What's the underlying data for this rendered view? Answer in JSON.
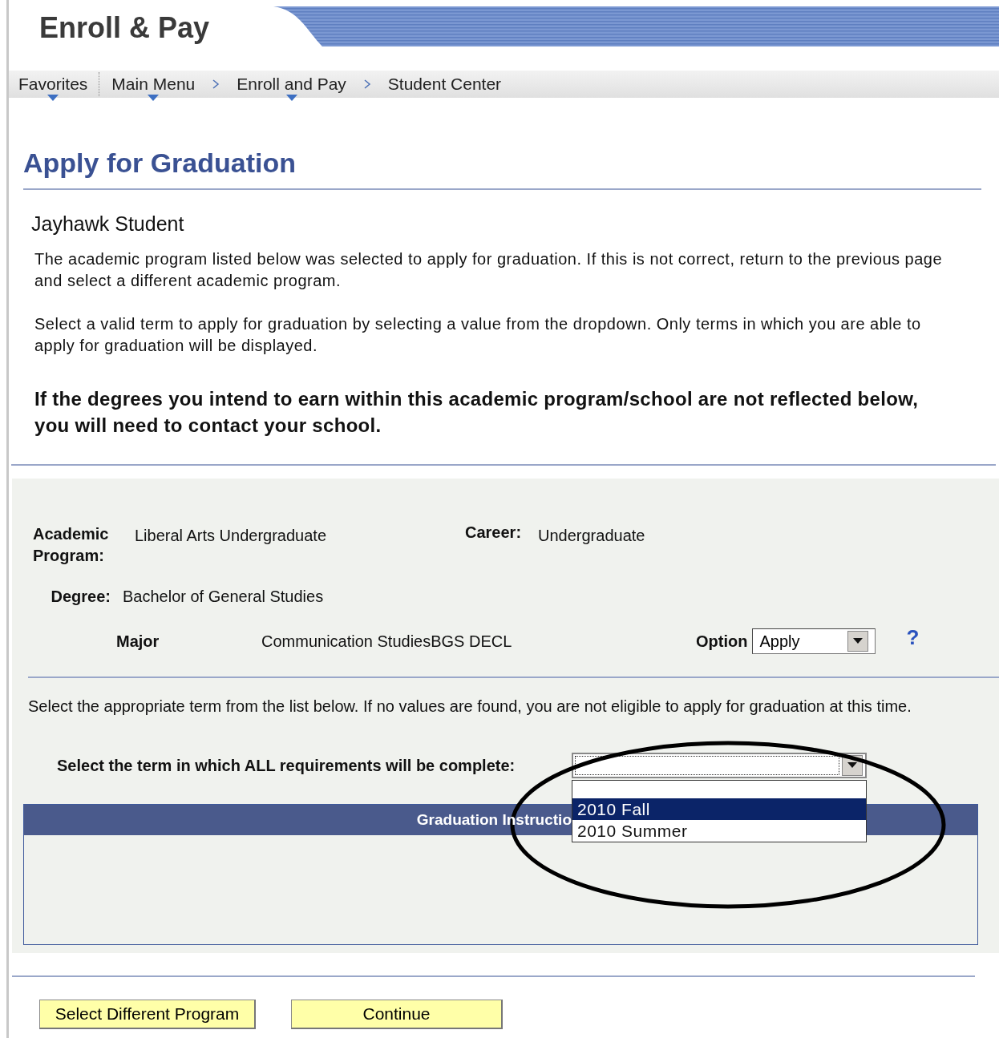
{
  "header": {
    "logo": "Enroll & Pay"
  },
  "breadcrumbs": [
    {
      "label": "Favorites",
      "menu": true
    },
    {
      "label": "Main Menu",
      "menu": true
    },
    {
      "label": "Enroll and Pay",
      "menu": true
    },
    {
      "label": "Student Center",
      "menu": false
    }
  ],
  "page": {
    "title": "Apply for Graduation",
    "student_name": "Jayhawk Student",
    "paragraphs": [
      "The academic program listed below was selected to apply for graduation. If this is not correct, return to the previous page and select a different academic program.",
      "Select a valid term to apply for graduation by selecting a value from the dropdown. Only terms in which you are able to apply for graduation will be displayed."
    ],
    "notice": "If the degrees you intend to earn within this academic program/school are not reflected below, you will need to contact your school."
  },
  "program": {
    "academic_program_label": "Academic Program:",
    "academic_program": "Liberal Arts Undergraduate",
    "career_label": "Career:",
    "career": "Undergraduate",
    "degree_label": "Degree:",
    "degree": "Bachelor of General Studies",
    "major_label": "Major",
    "major": "Communication StudiesBGS DECL",
    "option_label": "Option",
    "option_value": "Apply",
    "help": "?"
  },
  "term": {
    "instructions": "Select the appropriate term from the list below. If no values are found, you are not eligible to apply for graduation at this time.",
    "label": "Select the term in which ALL requirements will be complete:",
    "options": [
      {
        "label": "2010 Fall",
        "selected": true
      },
      {
        "label": "2010 Summer",
        "selected": false
      }
    ]
  },
  "instructions": {
    "header": "Graduation Instructio"
  },
  "buttons": [
    "Select Different Program",
    "Continue"
  ]
}
